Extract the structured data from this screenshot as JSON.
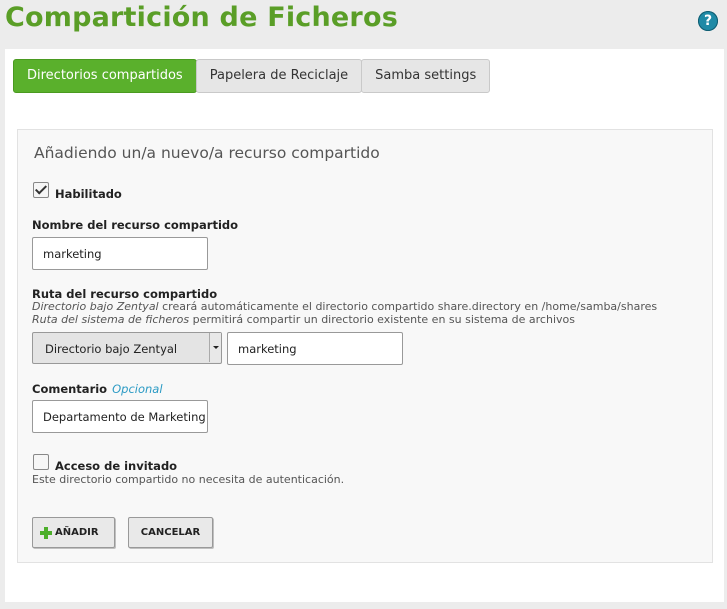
{
  "page": {
    "title": "Compartición de Ficheros",
    "help_label": "?"
  },
  "tabs": [
    {
      "label": "Directorios compartidos",
      "active": true
    },
    {
      "label": "Papelera de Reciclaje",
      "active": false
    },
    {
      "label": "Samba settings",
      "active": false
    }
  ],
  "form": {
    "heading": "Añadiendo un/a nuevo/a recurso compartido",
    "enabled": {
      "label": "Habilitado",
      "checked": true
    },
    "share_name": {
      "label": "Nombre del recurso compartido",
      "value": "marketing"
    },
    "share_path": {
      "label": "Ruta del recurso compartido",
      "help1_em": "Directorio bajo Zentyal",
      "help1_rest": " creará automáticamente el directorio compartido share.directory en /home/samba/shares",
      "help2_em": "Ruta del sistema de ficheros",
      "help2_rest": " permitirá compartir un directorio existente en su sistema de archivos",
      "select_value": "Directorio bajo Zentyal",
      "value": "marketing"
    },
    "comment": {
      "label": "Comentario",
      "optional": "Opcional",
      "value": "Departamento de Marketing"
    },
    "guest": {
      "label": "Acceso de invitado",
      "checked": false,
      "help": "Este directorio compartido no necesita de autenticación."
    },
    "buttons": {
      "add": "AÑADIR",
      "cancel": "CANCELAR"
    }
  },
  "colors": {
    "brand": "#5a9e27",
    "active_tab": "#5ab02c",
    "help": "#1f8aa6",
    "optional": "#2a9ac4"
  }
}
